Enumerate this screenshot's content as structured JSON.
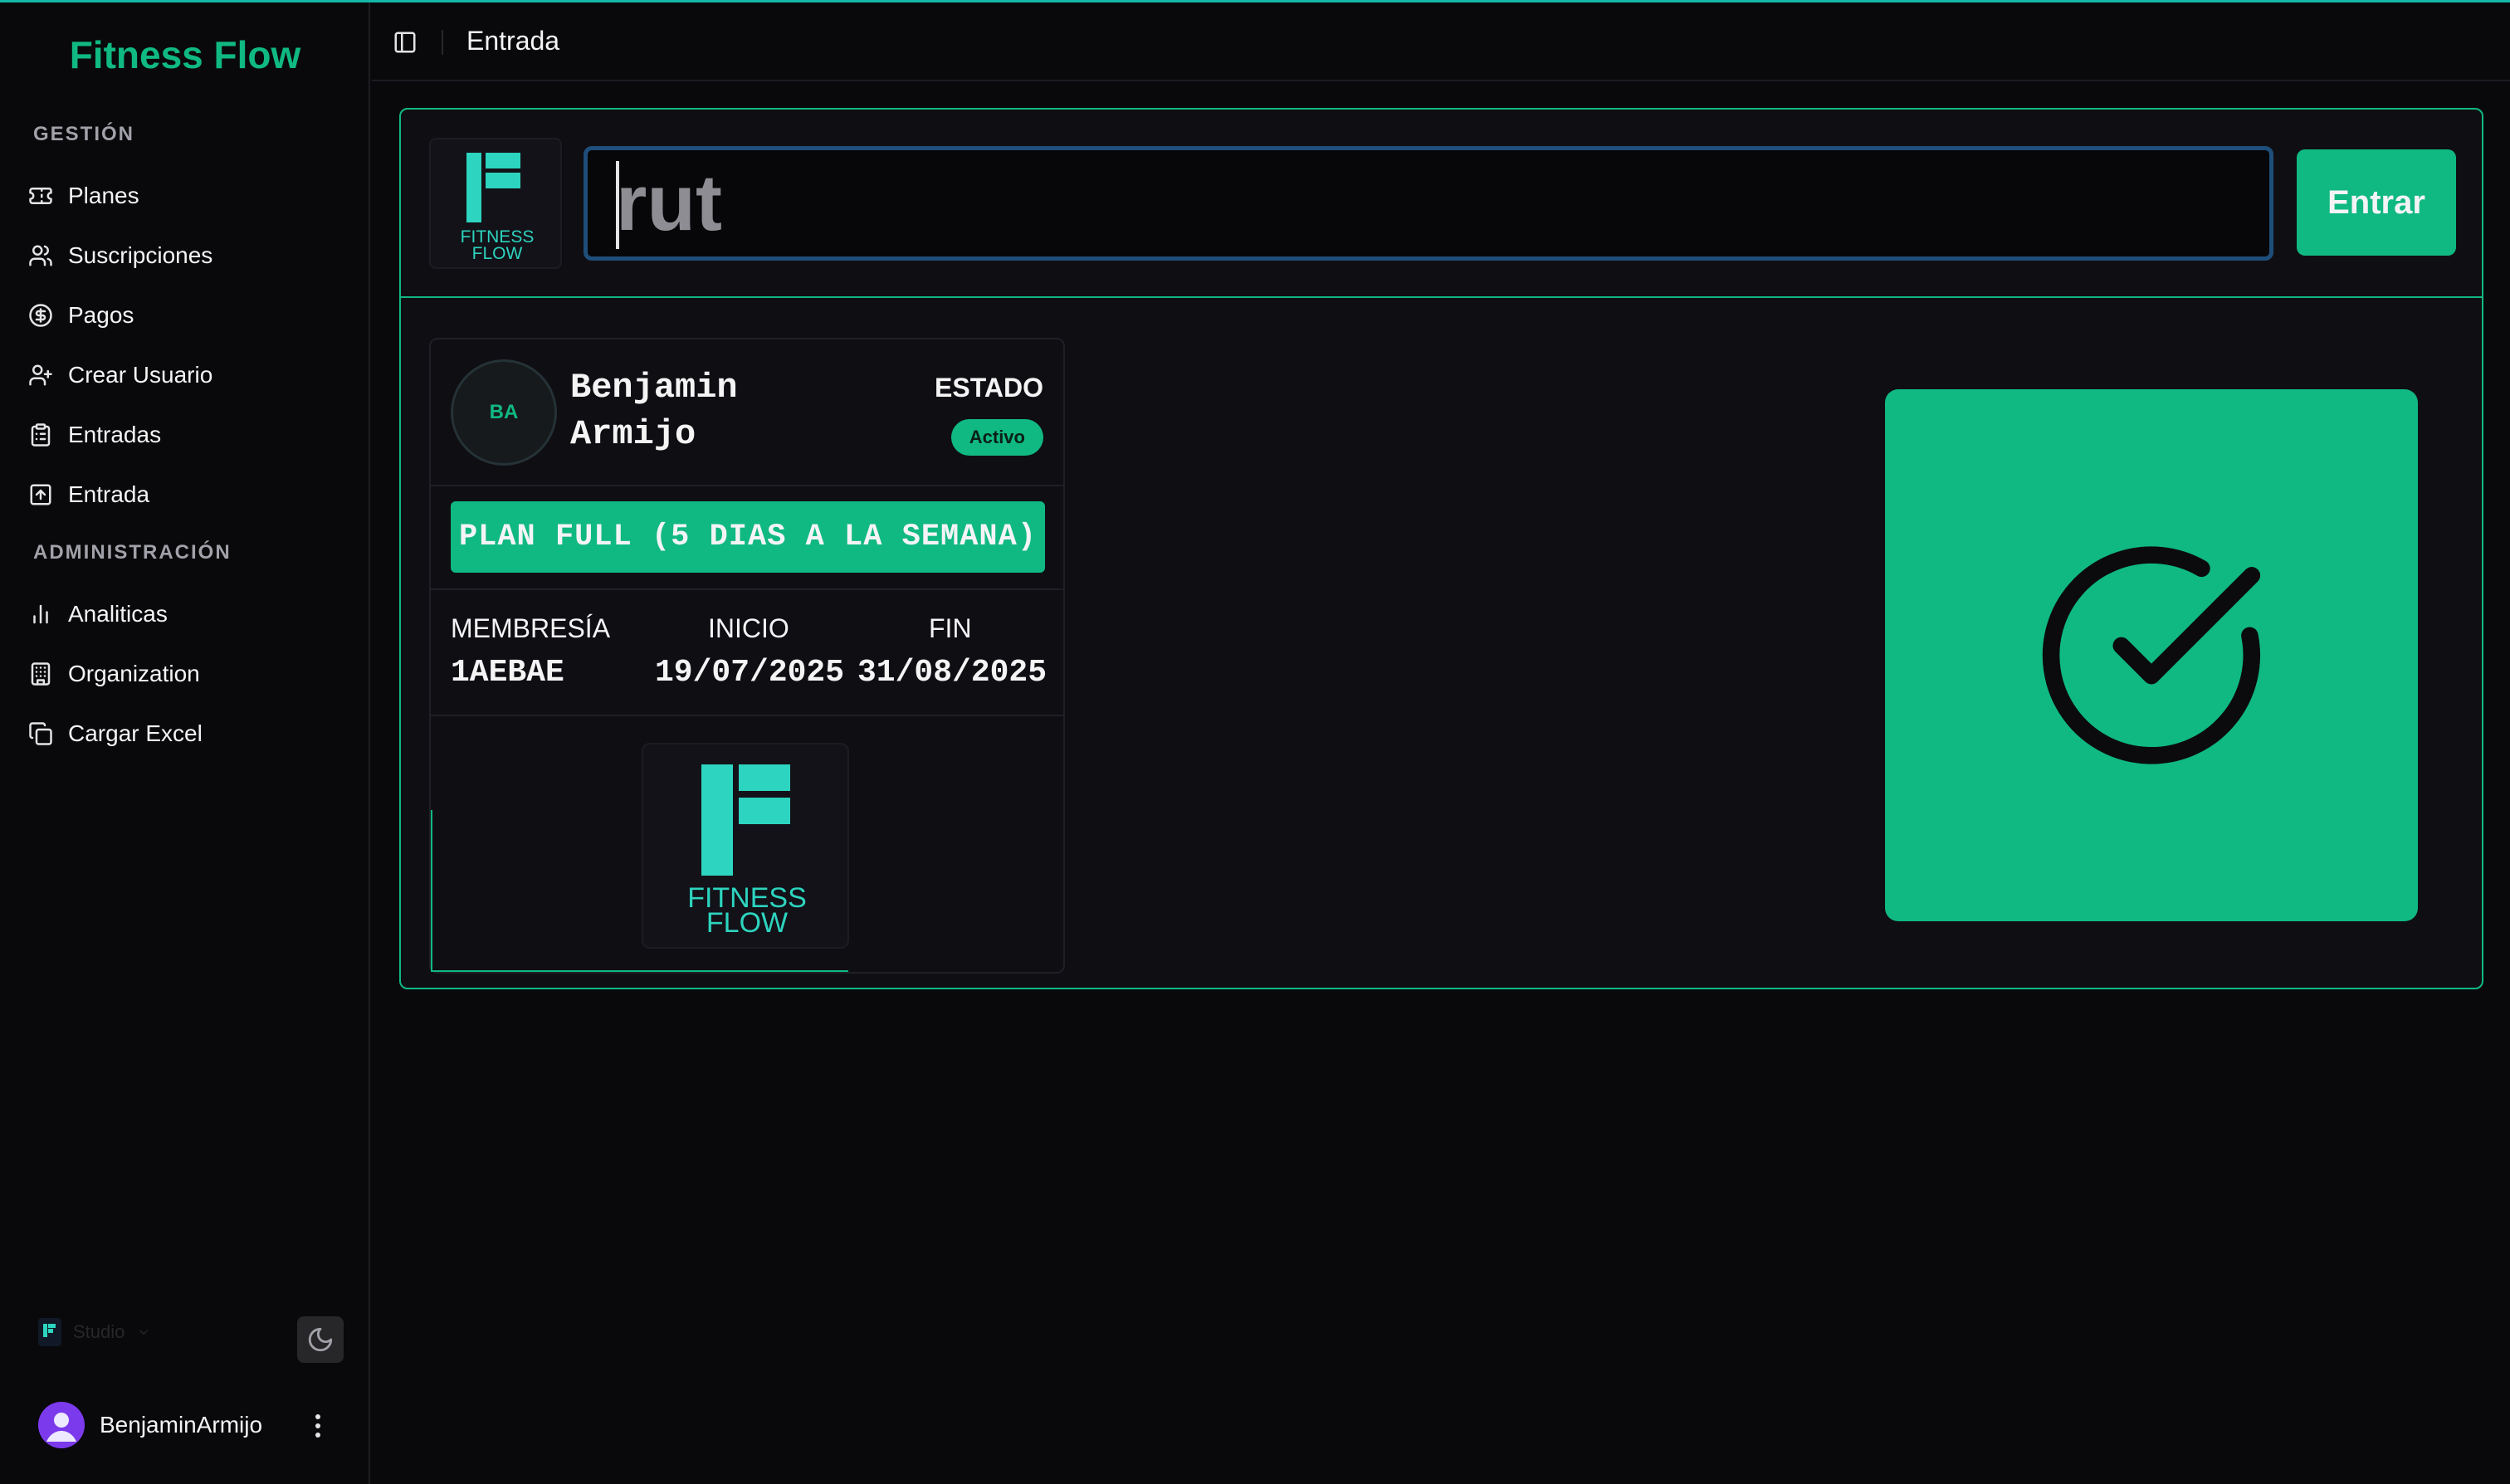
{
  "app": {
    "brand": "Fitness Flow"
  },
  "sidebar": {
    "groups": [
      {
        "label": "GESTIÓN",
        "items": [
          {
            "label": "Planes",
            "icon": "ticket-icon"
          },
          {
            "label": "Suscripciones",
            "icon": "users-icon"
          },
          {
            "label": "Pagos",
            "icon": "dollar-circle-icon"
          },
          {
            "label": "Crear Usuario",
            "icon": "user-plus-icon"
          },
          {
            "label": "Entradas",
            "icon": "clipboard-list-icon"
          },
          {
            "label": "Entrada",
            "icon": "square-arrow-up-icon"
          }
        ]
      },
      {
        "label": "ADMINISTRACIÓN",
        "items": [
          {
            "label": "Analiticas",
            "icon": "bar-chart-icon"
          },
          {
            "label": "Organization",
            "icon": "building-icon"
          },
          {
            "label": "Cargar Excel",
            "icon": "copy-icon"
          }
        ]
      }
    ],
    "org": {
      "name": "Studio"
    },
    "user": {
      "name": "BenjaminArmijo"
    }
  },
  "header": {
    "title": "Entrada"
  },
  "checkin": {
    "input": {
      "placeholder": "rut",
      "value": ""
    },
    "submit_label": "Entrar",
    "logo_text": [
      "FITNESS",
      "FLOW"
    ]
  },
  "member": {
    "initials": "BA",
    "first_name": "Benjamin",
    "last_name": "Armijo",
    "status_label": "ESTADO",
    "status": "Activo",
    "plan": "PLAN FULL (5 DIAS A LA SEMANA)",
    "columns": [
      {
        "label": "MEMBRESÍA",
        "value": "1AEBAE"
      },
      {
        "label": "INICIO",
        "value": "19/07/2025"
      },
      {
        "label": "FIN",
        "value": "31/08/2025"
      }
    ]
  },
  "result": {
    "state": "success",
    "icon": "check-circle-icon"
  },
  "colors": {
    "accent": "#10b981",
    "brand_logo": "#2dd4bf",
    "input_border": "#1e4e79",
    "background": "#09090c"
  }
}
